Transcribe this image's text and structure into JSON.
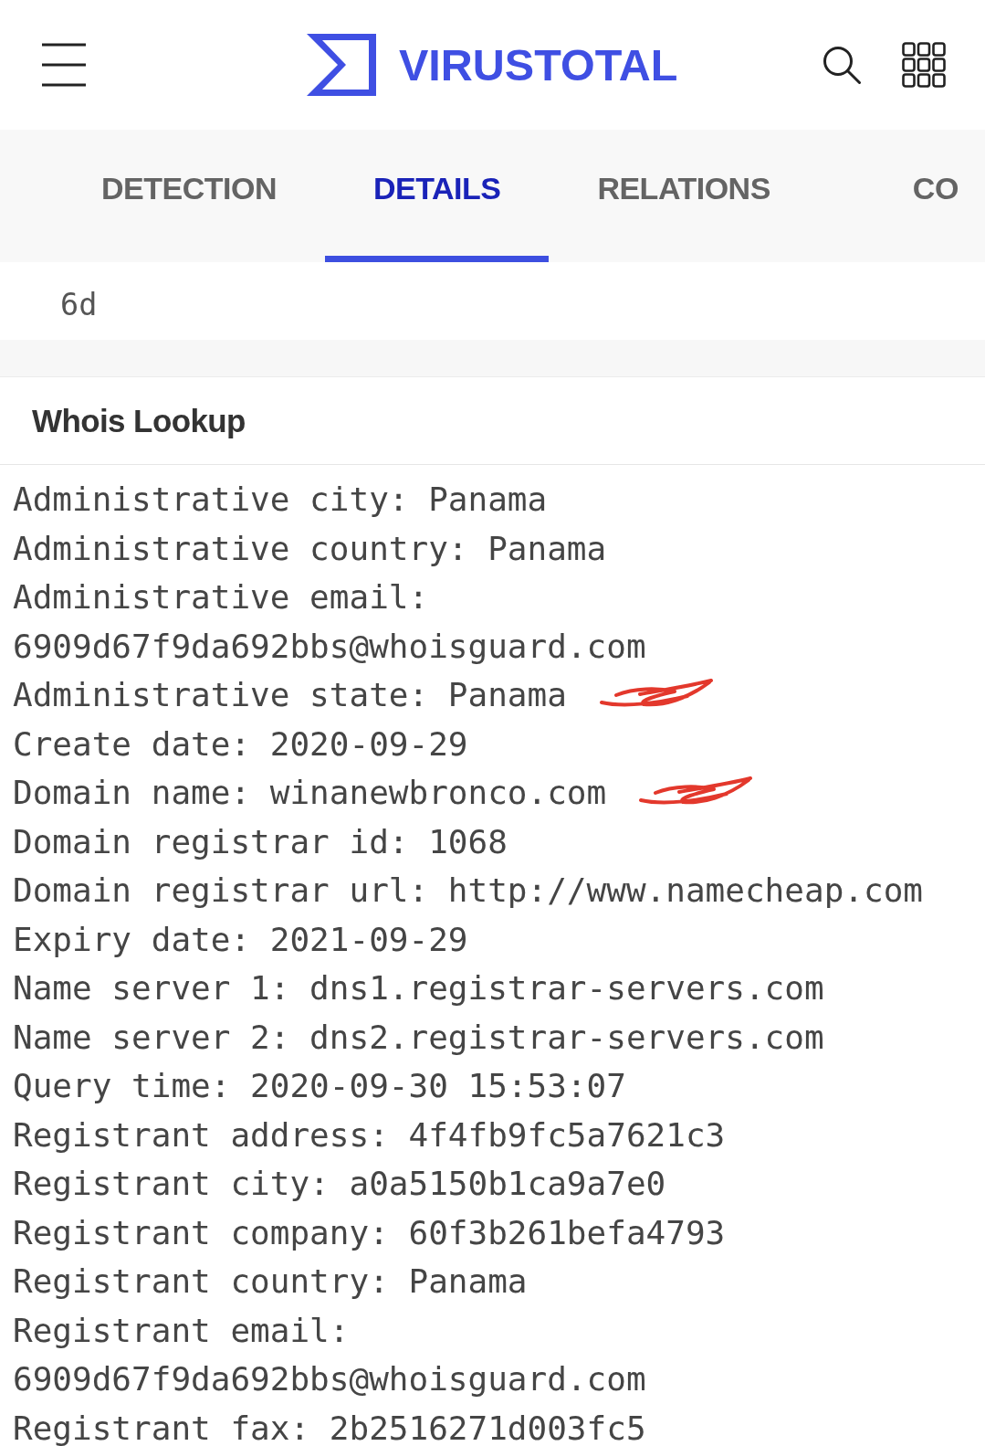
{
  "header": {
    "logo_text": "VIRUSTOTAL"
  },
  "tabs": [
    {
      "label": "DETECTION",
      "selected": false
    },
    {
      "label": "DETAILS",
      "selected": true
    },
    {
      "label": "RELATIONS",
      "selected": false
    },
    {
      "label": "CO",
      "selected": false
    }
  ],
  "previous_section": {
    "text": "6d"
  },
  "whois": {
    "title": "Whois Lookup",
    "entries": [
      {
        "text": "Administrative city: Panama",
        "marked": false
      },
      {
        "text": "Administrative country: Panama",
        "marked": false
      },
      {
        "text": "Administrative email: 6909d67f9da692bbs@whoisguard.com",
        "marked": false
      },
      {
        "text": "Administrative state: Panama",
        "marked": true
      },
      {
        "text": "Create date: 2020-09-29",
        "marked": false
      },
      {
        "text": "Domain name: winanewbronco.com",
        "marked": true
      },
      {
        "text": "Domain registrar id: 1068",
        "marked": false
      },
      {
        "text": "Domain registrar url: http://www.namecheap.com",
        "marked": false
      },
      {
        "text": "Expiry date: 2021-09-29",
        "marked": false
      },
      {
        "text": "Name server 1: dns1.registrar-servers.com",
        "marked": false
      },
      {
        "text": "Name server 2: dns2.registrar-servers.com",
        "marked": false
      },
      {
        "text": "Query time: 2020-09-30 15:53:07",
        "marked": false
      },
      {
        "text": "Registrant address: 4f4fb9fc5a7621c3",
        "marked": false
      },
      {
        "text": "Registrant city: a0a5150b1ca9a7e0",
        "marked": false
      },
      {
        "text": "Registrant company: 60f3b261befa4793",
        "marked": false
      },
      {
        "text": "Registrant country: Panama",
        "marked": false
      },
      {
        "text": "Registrant email: 6909d67f9da692bbs@whoisguard.com",
        "marked": false
      },
      {
        "text": "Registrant fax: 2b2516271d003fc5",
        "marked": false
      }
    ]
  }
}
